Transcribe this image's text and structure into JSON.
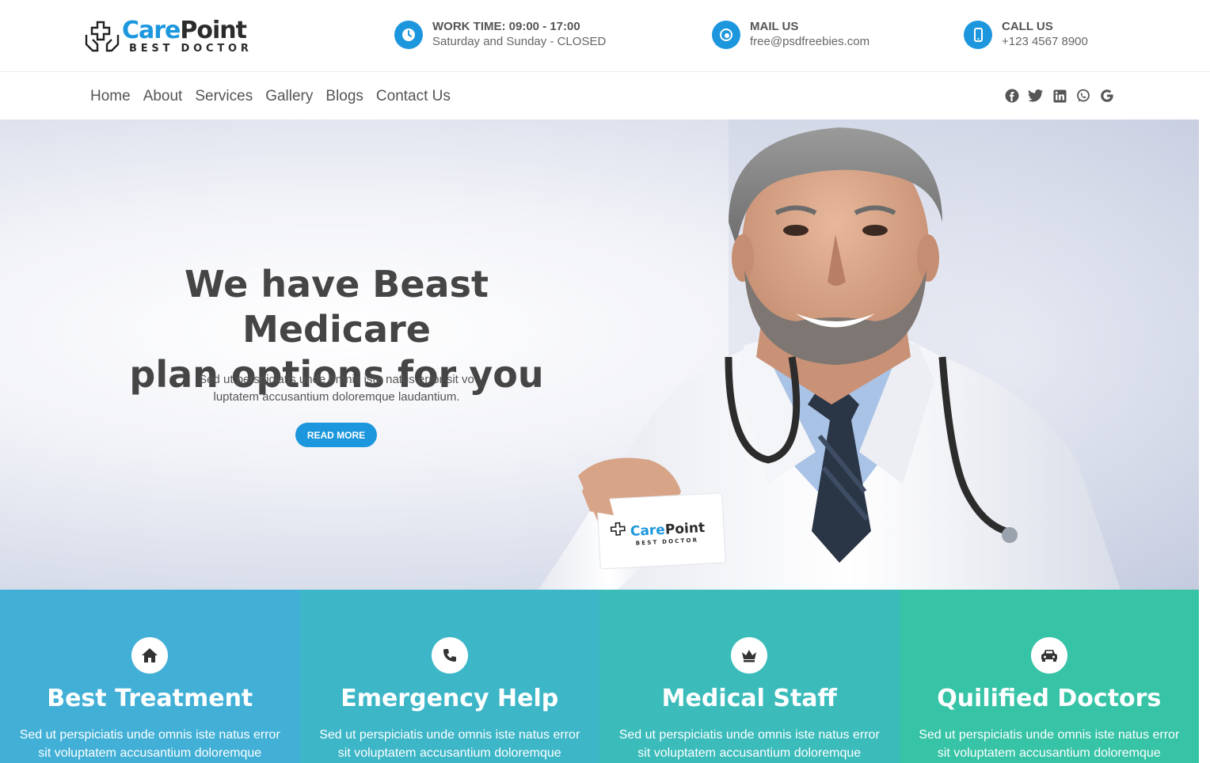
{
  "brand": {
    "name_part1": "Care",
    "name_part2": "Point",
    "tagline": "BEST DOCTOR"
  },
  "header_info": [
    {
      "icon": "clock-icon",
      "label": "WORK TIME: 09:00 - 17:00",
      "value": "Saturday and Sunday - CLOSED"
    },
    {
      "icon": "mail-icon",
      "label": "MAIL US",
      "value": "free@psdfreebies.com"
    },
    {
      "icon": "phone-icon",
      "label": "CALL US",
      "value": "+123 4567 8900"
    }
  ],
  "nav": [
    "Home",
    "About",
    "Services",
    "Gallery",
    "Blogs",
    "Contact Us"
  ],
  "social": [
    "facebook-icon",
    "twitter-icon",
    "linkedin-icon",
    "whatsapp-icon",
    "google-icon"
  ],
  "hero": {
    "headline_line1": "We have Beast Medicare",
    "headline_line2": "plan options for you",
    "sub_line1": "Sed ut perspiciatis unde omnis iste natus error sit vo",
    "sub_line2": "luptatem accusantium doloremque laudantium.",
    "cta": "READ MORE",
    "card_brand1": "Care",
    "card_brand2": "Point",
    "card_tag": "BEST DOCTOR"
  },
  "features": [
    {
      "icon": "home-icon",
      "title": "Best Treatment",
      "line1": "Sed ut perspiciatis unde omnis iste natus error",
      "line2": "sit voluptatem accusantium doloremque",
      "color": "#42b0d6"
    },
    {
      "icon": "phone-handset-icon",
      "title": "Emergency Help",
      "line1": "Sed ut perspiciatis unde omnis iste natus error",
      "line2": "sit voluptatem accusantium doloremque",
      "color": "#3db6c7"
    },
    {
      "icon": "crown-icon",
      "title": "Medical Staff",
      "line1": "Sed ut perspiciatis unde omnis iste natus error",
      "line2": "sit voluptatem accusantium doloremque",
      "color": "#3bbcbb"
    },
    {
      "icon": "ambulance-icon",
      "title": "Quilified Doctors",
      "line1": "Sed ut perspiciatis unde omnis iste natus error",
      "line2": "sit voluptatem accusantium doloremque",
      "color": "#36c3a6"
    }
  ],
  "colors": {
    "accent": "#1c97dd",
    "text_dark": "#454545"
  }
}
